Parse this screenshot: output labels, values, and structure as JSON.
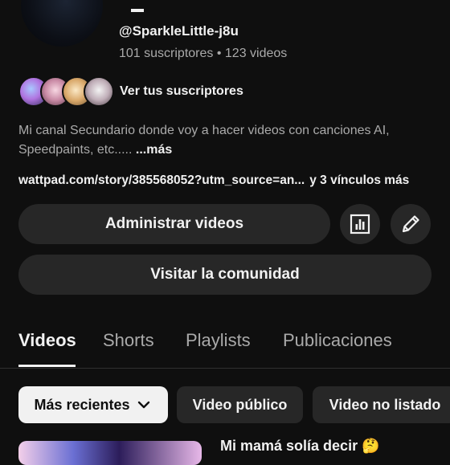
{
  "channel": {
    "handle": "@SparkleLittle-j8u",
    "subscribers": "101 suscriptores",
    "separator": "•",
    "videos_count": "123 videos",
    "subscribers_link": "Ver tus suscriptores",
    "description": "Mi canal Secundario donde voy a hacer videos con canciones AI, Speedpaints, etc.....",
    "more_label": "...más",
    "link_url": "wattpad.com/story/385568052?utm_source=an...",
    "more_links": "y 3 vínculos más"
  },
  "actions": {
    "manage_label": "Administrar videos",
    "community_label": "Visitar la comunidad",
    "stats_icon": "analytics-icon",
    "edit_icon": "pencil-icon"
  },
  "tabs": [
    {
      "label": "Videos",
      "active": true
    },
    {
      "label": "Shorts"
    },
    {
      "label": "Playlists"
    },
    {
      "label": "Publicaciones"
    }
  ],
  "filters": [
    {
      "label": "Más recientes",
      "selected": true,
      "icon": "chevron-down-icon"
    },
    {
      "label": "Video público"
    },
    {
      "label": "Video no listado"
    }
  ],
  "videos": [
    {
      "title": "Mi mamá solía decir 🤔"
    }
  ]
}
